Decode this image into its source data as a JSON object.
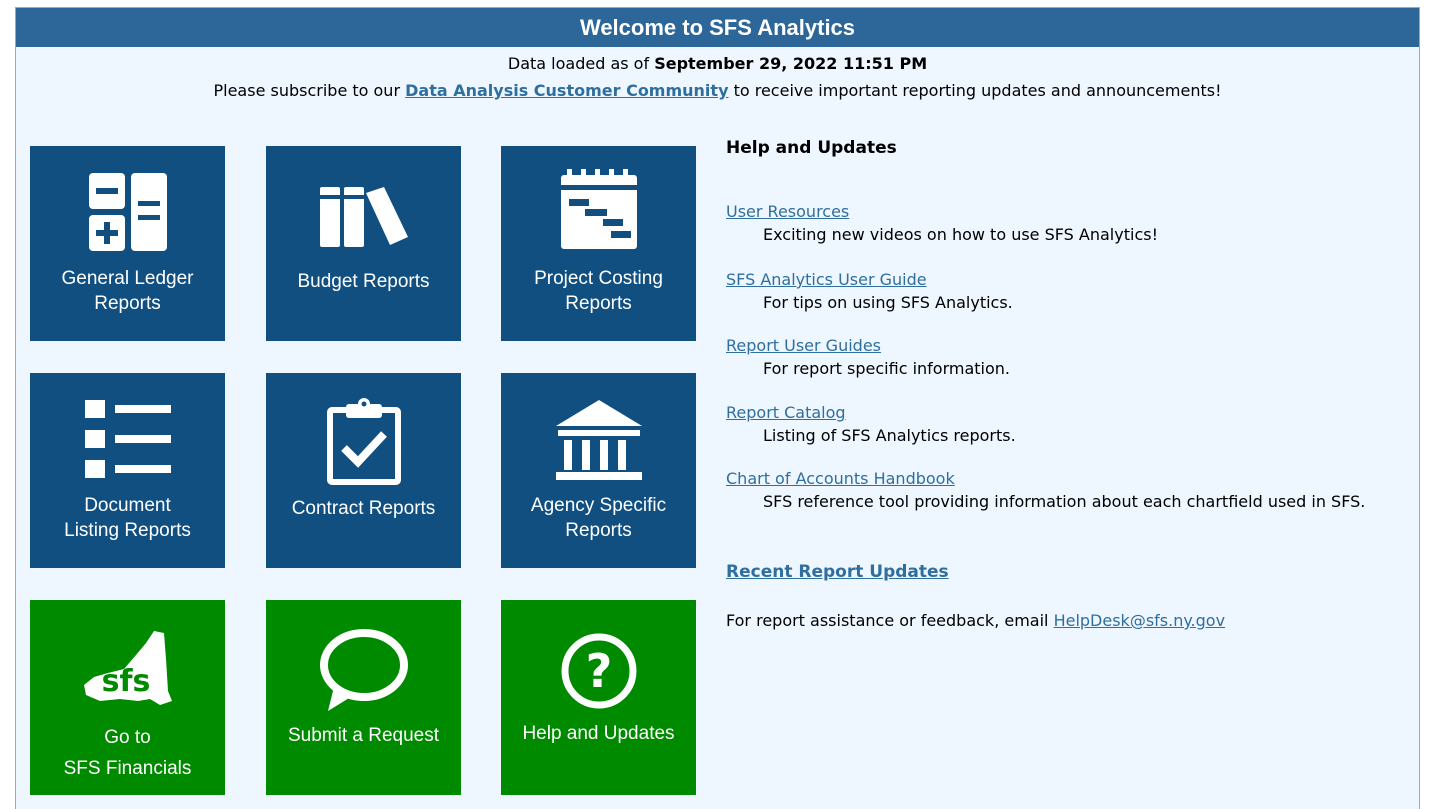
{
  "header": {
    "title": "Welcome to SFS Analytics"
  },
  "loaded": {
    "prefix": "Data loaded as of ",
    "date": "September 29, 2022 11:51 PM"
  },
  "subscribe": {
    "prefix": "Please subscribe to our ",
    "link": "Data Analysis Customer Community",
    "suffix": " to receive important reporting updates and announcements!"
  },
  "tiles": [
    {
      "line1": "General Ledger",
      "line2": "Reports",
      "icon": "calculator-icon",
      "color": "#104f80"
    },
    {
      "line1": "Budget Reports",
      "icon": "books-icon",
      "color": "#104f80"
    },
    {
      "line1": "Project Costing",
      "line2": "Reports",
      "icon": "gantt-calendar-icon",
      "color": "#104f80"
    },
    {
      "line1": "Document",
      "line2": "Listing Reports",
      "icon": "list-icon",
      "color": "#104f80"
    },
    {
      "line1": "Contract Reports",
      "icon": "clipboard-check-icon",
      "color": "#104f80"
    },
    {
      "line1": "Agency Specific",
      "line2": "Reports",
      "icon": "building-columns-icon",
      "color": "#104f80"
    },
    {
      "line1": "Go to",
      "line2": "SFS Financials",
      "icon": "sfs-logo-icon",
      "color": "#008a00"
    },
    {
      "line1": "Submit a Request",
      "icon": "speech-bubble-icon",
      "color": "#008a00"
    },
    {
      "line1": "Help and Updates",
      "icon": "question-circle-icon",
      "color": "#008a00"
    }
  ],
  "help": {
    "title": "Help and Updates",
    "items": [
      {
        "link": "User Resources",
        "desc": "Exciting new videos on how to use SFS Analytics!"
      },
      {
        "link": "SFS Analytics User Guide",
        "desc": "For tips on using SFS Analytics."
      },
      {
        "link": "Report User Guides",
        "desc": "For report specific information."
      },
      {
        "link": "Report Catalog",
        "desc": "Listing of SFS Analytics reports."
      },
      {
        "link": "Chart of Accounts Handbook",
        "desc": "SFS reference tool providing information about each chartfield used in SFS."
      }
    ],
    "recent": "Recent Report Updates",
    "contact_prefix": "For report assistance or feedback, email ",
    "contact_email": "HelpDesk@sfs.ny.gov"
  },
  "colors": {
    "header": "#2d6699",
    "tile_blue": "#104f80",
    "tile_green": "#008a00",
    "link": "#2e6f9e",
    "panel": "#eef6ff"
  }
}
